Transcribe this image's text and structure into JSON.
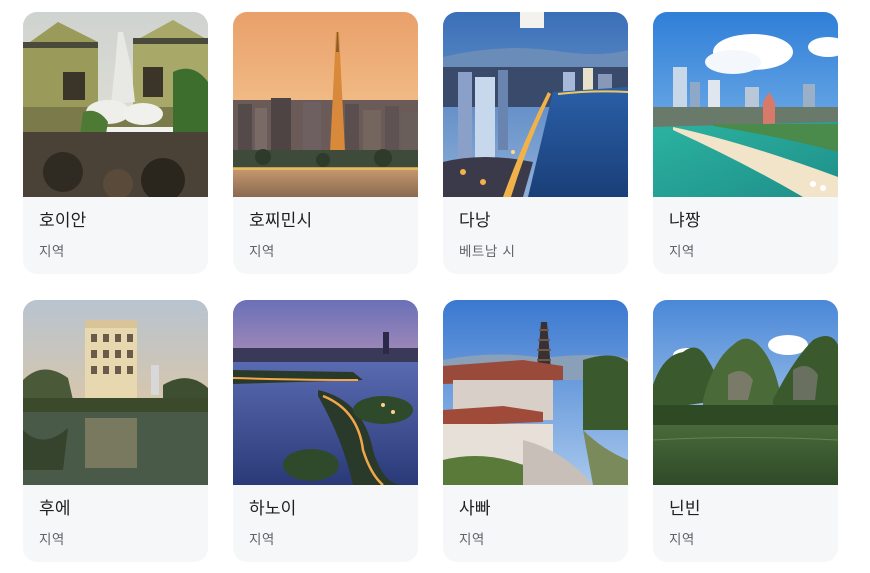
{
  "destinations": [
    {
      "name": "호이안",
      "type": "지역",
      "image": "hoi-an-statue-photo"
    },
    {
      "name": "호찌민시",
      "type": "지역",
      "image": "ho-chi-minh-skyline-photo"
    },
    {
      "name": "다낭",
      "type": "베트남 시",
      "image": "da-nang-river-night-photo"
    },
    {
      "name": "냐짱",
      "type": "지역",
      "image": "nha-trang-beach-photo"
    },
    {
      "name": "후에",
      "type": "지역",
      "image": "hue-building-lake-photo"
    },
    {
      "name": "하노이",
      "type": "지역",
      "image": "hanoi-lake-dusk-photo"
    },
    {
      "name": "사빠",
      "type": "지역",
      "image": "sapa-pagoda-photo"
    },
    {
      "name": "닌빈",
      "type": "지역",
      "image": "ninh-binh-karst-photo"
    }
  ]
}
